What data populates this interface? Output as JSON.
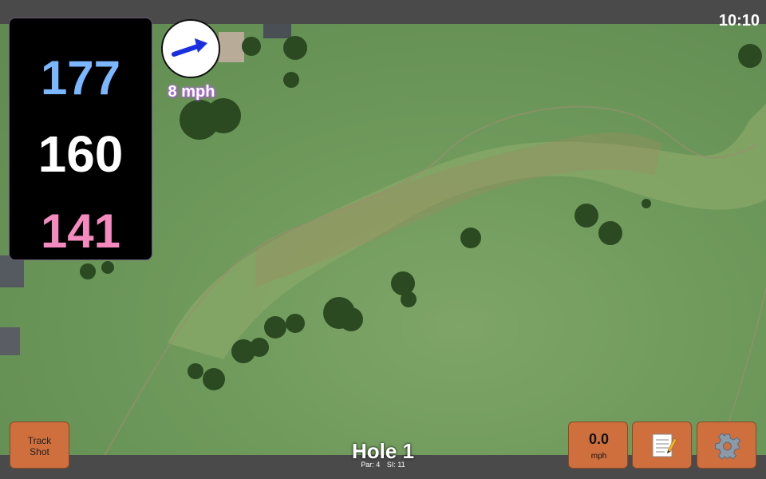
{
  "status": {
    "clock": "10:10"
  },
  "distances": {
    "back": "177",
    "center": "160",
    "front": "141"
  },
  "wind": {
    "speed": "8 mph",
    "direction_icon": "wind-arrow-icon"
  },
  "buttons": {
    "track_line1": "Track",
    "track_line2": "Shot",
    "speed_value": "0.0",
    "speed_unit": "mph",
    "notes_icon": "notes-icon",
    "settings_icon": "gear-icon"
  },
  "hole": {
    "title": "Hole 1",
    "par": "Par: 4",
    "si": "SI: 11"
  },
  "colors": {
    "back_distance": "#7ab7ff",
    "center_distance": "#ffffff",
    "front_distance": "#f48bbf",
    "button": "#cf6f3e"
  }
}
